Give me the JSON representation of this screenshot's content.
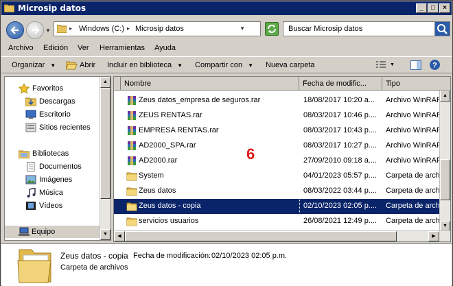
{
  "window": {
    "title": "Microsip datos"
  },
  "address": {
    "segments": [
      "Windows (C:)",
      "Microsip datos"
    ],
    "search_placeholder": "Buscar Microsip datos"
  },
  "menu": [
    "Archivo",
    "Edición",
    "Ver",
    "Herramientas",
    "Ayuda"
  ],
  "commands": {
    "organize": "Organizar",
    "open": "Abrir",
    "include": "Incluir en biblioteca",
    "share": "Compartir con",
    "new_folder": "Nueva carpeta"
  },
  "nav": {
    "favorites": "Favoritos",
    "downloads": "Descargas",
    "desktop": "Escritorio",
    "recent": "Sitios recientes",
    "libraries": "Bibliotecas",
    "documents": "Documentos",
    "images": "Imágenes",
    "music": "Música",
    "videos": "Vídeos",
    "computer": "Equipo"
  },
  "columns": {
    "name": "Nombre",
    "date": "Fecha de modific...",
    "type": "Tipo"
  },
  "files": [
    {
      "name": "Zeus datos_empresa de seguros.rar",
      "date": "18/08/2017 10:20 a...",
      "type": "Archivo WinRAR",
      "icon": "rar"
    },
    {
      "name": "ZEUS RENTAS.rar",
      "date": "08/03/2017 10:46 p....",
      "type": "Archivo WinRAR",
      "icon": "rar"
    },
    {
      "name": "EMPRESA RENTAS.rar",
      "date": "08/03/2017 10:43 p....",
      "type": "Archivo WinRAR",
      "icon": "rar"
    },
    {
      "name": "AD2000_SPA.rar",
      "date": "08/03/2017 10:27 p....",
      "type": "Archivo WinRAR",
      "icon": "rar"
    },
    {
      "name": "AD2000.rar",
      "date": "27/09/2010 09:18 a....",
      "type": "Archivo WinRAR",
      "icon": "rar"
    },
    {
      "name": "System",
      "date": "04/01/2023 05:57 p....",
      "type": "Carpeta de archi",
      "icon": "folder"
    },
    {
      "name": "Zeus datos",
      "date": "08/03/2022 03:44 p....",
      "type": "Carpeta de archi",
      "icon": "folder"
    },
    {
      "name": "Zeus datos - copia",
      "date": "02/10/2023 02:05 p....",
      "type": "Carpeta de archi",
      "icon": "folder"
    },
    {
      "name": "servicios usuarios",
      "date": "26/08/2021 12:49 p....",
      "type": "Carpeta de archi",
      "icon": "folder"
    }
  ],
  "selected_index": 7,
  "overlay_number": "6",
  "details": {
    "name": "Zeus datos - copia",
    "date_label": "Fecha de modificación:",
    "date_value": "02/10/2023 02:05 p.m.",
    "type": "Carpeta de archivos"
  }
}
